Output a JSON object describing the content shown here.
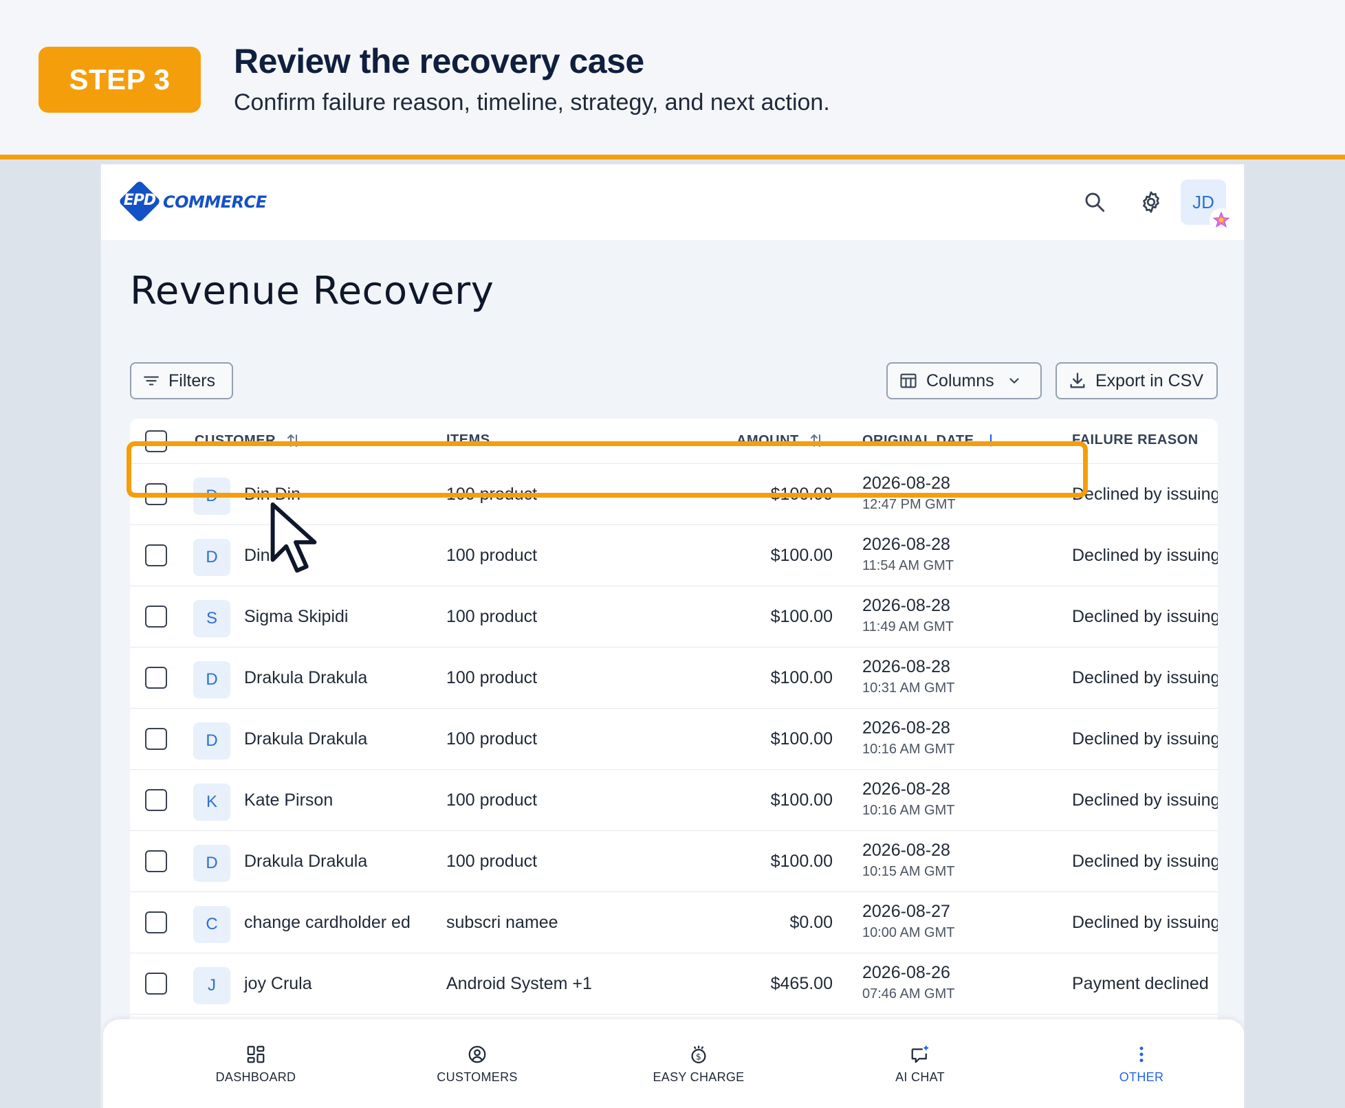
{
  "banner": {
    "step": "STEP 3",
    "title": "Review the recovery case",
    "subtitle": "Confirm failure reason, timeline, strategy, and next action."
  },
  "app": {
    "logo": {
      "mark": "EPD",
      "word": "COMMERCE"
    },
    "header_icons": [
      "search-icon",
      "gear-icon"
    ],
    "avatar": "JD",
    "page_title": "Revenue Recovery",
    "toolbar": {
      "filters_label": "Filters",
      "columns_label": "Columns",
      "export_label": "Export in CSV"
    },
    "columns": {
      "customer": "CUSTOMER",
      "items": "ITEMS",
      "amount": "AMOUNT",
      "original_date": "ORIGINAL DATE",
      "failure_reason": "FAILURE REASON"
    },
    "rows": [
      {
        "initial": "D",
        "customer": "Din Din",
        "items": "100 product",
        "amount": "$100.00",
        "date": "2026-08-28",
        "time": "12:47 PM GMT",
        "reason": "Declined by issuing"
      },
      {
        "initial": "D",
        "customer": "Din",
        "items": "100 product",
        "amount": "$100.00",
        "date": "2026-08-28",
        "time": "11:54 AM GMT",
        "reason": "Declined by issuing"
      },
      {
        "initial": "S",
        "customer": "Sigma Skipidi",
        "items": "100 product",
        "amount": "$100.00",
        "date": "2026-08-28",
        "time": "11:49 AM GMT",
        "reason": "Declined by issuing"
      },
      {
        "initial": "D",
        "customer": "Drakula Drakula",
        "items": "100 product",
        "amount": "$100.00",
        "date": "2026-08-28",
        "time": "10:31 AM GMT",
        "reason": "Declined by issuing"
      },
      {
        "initial": "D",
        "customer": "Drakula Drakula",
        "items": "100 product",
        "amount": "$100.00",
        "date": "2026-08-28",
        "time": "10:16 AM GMT",
        "reason": "Declined by issuing"
      },
      {
        "initial": "K",
        "customer": "Kate Pirson",
        "items": "100 product",
        "amount": "$100.00",
        "date": "2026-08-28",
        "time": "10:16 AM GMT",
        "reason": "Declined by issuing"
      },
      {
        "initial": "D",
        "customer": "Drakula Drakula",
        "items": "100 product",
        "amount": "$100.00",
        "date": "2026-08-28",
        "time": "10:15 AM GMT",
        "reason": "Declined by issuing"
      },
      {
        "initial": "C",
        "customer": "change cardholder ed",
        "items": "subscri namee",
        "amount": "$0.00",
        "date": "2026-08-27",
        "time": "10:00 AM GMT",
        "reason": "Declined by issuing"
      },
      {
        "initial": "J",
        "customer": "joy Crula",
        "items": "Android System +1",
        "amount": "$465.00",
        "date": "2026-08-26",
        "time": "07:46 AM GMT",
        "reason": "Payment declined"
      }
    ],
    "nav": [
      {
        "label": "DASHBOARD",
        "icon": "dashboard-icon"
      },
      {
        "label": "CUSTOMERS",
        "icon": "customers-icon"
      },
      {
        "label": "EASY CHARGE",
        "icon": "easy-charge-icon"
      },
      {
        "label": "AI CHAT",
        "icon": "ai-chat-icon"
      },
      {
        "label": "OTHER",
        "icon": "more-vertical-icon",
        "active": true
      }
    ],
    "colors": {
      "accent": "#f59e0b",
      "brand": "#1451c4",
      "link": "#2563eb"
    }
  }
}
